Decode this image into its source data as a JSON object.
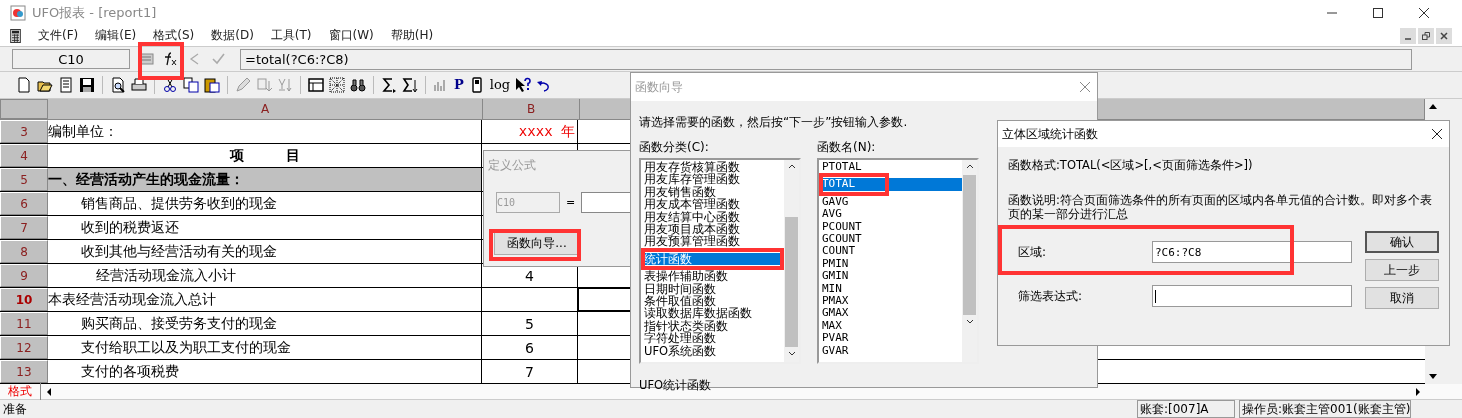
{
  "window": {
    "title": "UFO报表 - [report1]"
  },
  "menu": [
    "文件(F)",
    "编辑(E)",
    "格式(S)",
    "数据(D)",
    "工具(T)",
    "窗口(W)",
    "帮助(H)"
  ],
  "formula_bar": {
    "cell": "C10",
    "formula": "=total(?C6:?C8)"
  },
  "toolbar_text": [
    "P",
    "log"
  ],
  "sheet": {
    "columns": [
      "A",
      "B"
    ],
    "rows": [
      {
        "number": "3",
        "kind": "unit",
        "a": "编制单位：",
        "b": "xxxx 年",
        "selected": false
      },
      {
        "number": "4",
        "kind": "header",
        "a": "项　　　目",
        "selected": false
      },
      {
        "number": "5",
        "kind": "section",
        "a": "一、经营活动产生的现金流量：",
        "selected": false
      },
      {
        "number": "6",
        "kind": "item",
        "a": "销售商品、提供劳务收到的现金",
        "selected": false
      },
      {
        "number": "7",
        "kind": "item",
        "a": "收到的税费返还",
        "selected": false
      },
      {
        "number": "8",
        "kind": "item",
        "a": "收到其他与经营活动有关的现金",
        "selected": false
      },
      {
        "number": "9",
        "kind": "subtotal",
        "a": "经营活动现金流入小计",
        "b": "4",
        "selected": false
      },
      {
        "number": "10",
        "kind": "total",
        "a": "本表经营活动现金流入总计",
        "selected": true
      },
      {
        "number": "11",
        "kind": "item",
        "a": "购买商品、接受劳务支付的现金",
        "b": "5",
        "selected": false
      },
      {
        "number": "12",
        "kind": "item",
        "a": "支付给职工以及为职工支付的现金",
        "b": "6",
        "selected": false
      },
      {
        "number": "13",
        "kind": "item",
        "a": "支付的各项税费",
        "b": "7",
        "selected": false
      }
    ]
  },
  "define_formula": {
    "title": "定义公式",
    "active": false,
    "cell": {
      "value": "C10",
      "disabled": true
    },
    "equals": "=",
    "button": "函数向导..."
  },
  "wizard": {
    "title": "函数向导",
    "active": false,
    "instruction": "请选择需要的函数，然后按“下一步”按钮输入参数.",
    "category_label": "函数分类(C):",
    "name_label": "函数名(N):",
    "categories": [
      {
        "label": "用友存货核算函数",
        "selected": false
      },
      {
        "label": "用友库存管理函数",
        "selected": false
      },
      {
        "label": "用友销售函数",
        "selected": false
      },
      {
        "label": "用友成本管理函数",
        "selected": false
      },
      {
        "label": "用友结算中心函数",
        "selected": false
      },
      {
        "label": "用友项目成本函数",
        "selected": false
      },
      {
        "label": "用友预算管理函数",
        "selected": false
      },
      {
        "label": "统计函数",
        "selected": true
      },
      {
        "label": "表操作辅助函数",
        "selected": false
      },
      {
        "label": "日期时间函数",
        "selected": false
      },
      {
        "label": "条件取值函数",
        "selected": false
      },
      {
        "label": "读取数据库数据函数",
        "selected": false
      },
      {
        "label": "指针状态类函数",
        "selected": false
      },
      {
        "label": "字符处理函数",
        "selected": false
      },
      {
        "label": "UFO系统函数",
        "selected": false
      }
    ],
    "functions": [
      {
        "label": "PTOTAL",
        "selected": false
      },
      {
        "label": "TOTAL",
        "selected": true
      },
      {
        "label": "GAVG",
        "selected": false
      },
      {
        "label": "AVG",
        "selected": false
      },
      {
        "label": "PCOUNT",
        "selected": false
      },
      {
        "label": "GCOUNT",
        "selected": false
      },
      {
        "label": "COUNT",
        "selected": false
      },
      {
        "label": "PMIN",
        "selected": false
      },
      {
        "label": "GMIN",
        "selected": false
      },
      {
        "label": "MIN",
        "selected": false
      },
      {
        "label": "PMAX",
        "selected": false
      },
      {
        "label": "GMAX",
        "selected": false
      },
      {
        "label": "MAX",
        "selected": false
      },
      {
        "label": "PVAR",
        "selected": false
      },
      {
        "label": "GVAR",
        "selected": false
      }
    ],
    "footer": "UFO统计函数"
  },
  "total_dialog": {
    "title": "立体区域统计函数",
    "active": true,
    "format": "函数格式:TOTAL(<区域>[,<页面筛选条件>])",
    "description": "函数说明:符合页面筛选条件的所有页面的区域内各单元值的合计数。即对多个表页的某一部分进行汇总",
    "fields": [
      {
        "label": "区域:",
        "value": "?C6:?C8"
      },
      {
        "label": "筛选表达式:"
      }
    ],
    "buttons": [
      "确认",
      "上一步",
      "取消"
    ]
  },
  "sheet_tab": "格式",
  "status_bar": [
    "准备",
    "账套:[007]A",
    "操作员:账套主管001(账套主管)"
  ]
}
